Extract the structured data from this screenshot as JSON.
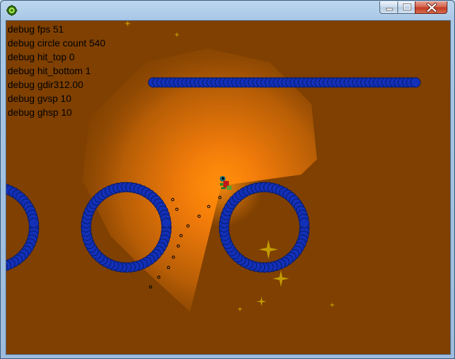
{
  "window": {
    "icon": "gear-icon",
    "buttons": {
      "minimize": "minimize-icon",
      "maximize": "maximize-icon",
      "close": "close-icon"
    }
  },
  "debug_lines": [
    "debug fps 51",
    "debug circle count 540",
    "debug hit_top 0",
    "debug hit_bottom 1",
    "debug gdir312.00",
    "debug gvsp 10",
    "debug ghsp 10"
  ],
  "colors": {
    "background": "#7f4001",
    "light": "#ff8a00",
    "circle_fill": "#1330b8",
    "circle_stroke": "#061a66",
    "sparkle": "#d8b800"
  }
}
